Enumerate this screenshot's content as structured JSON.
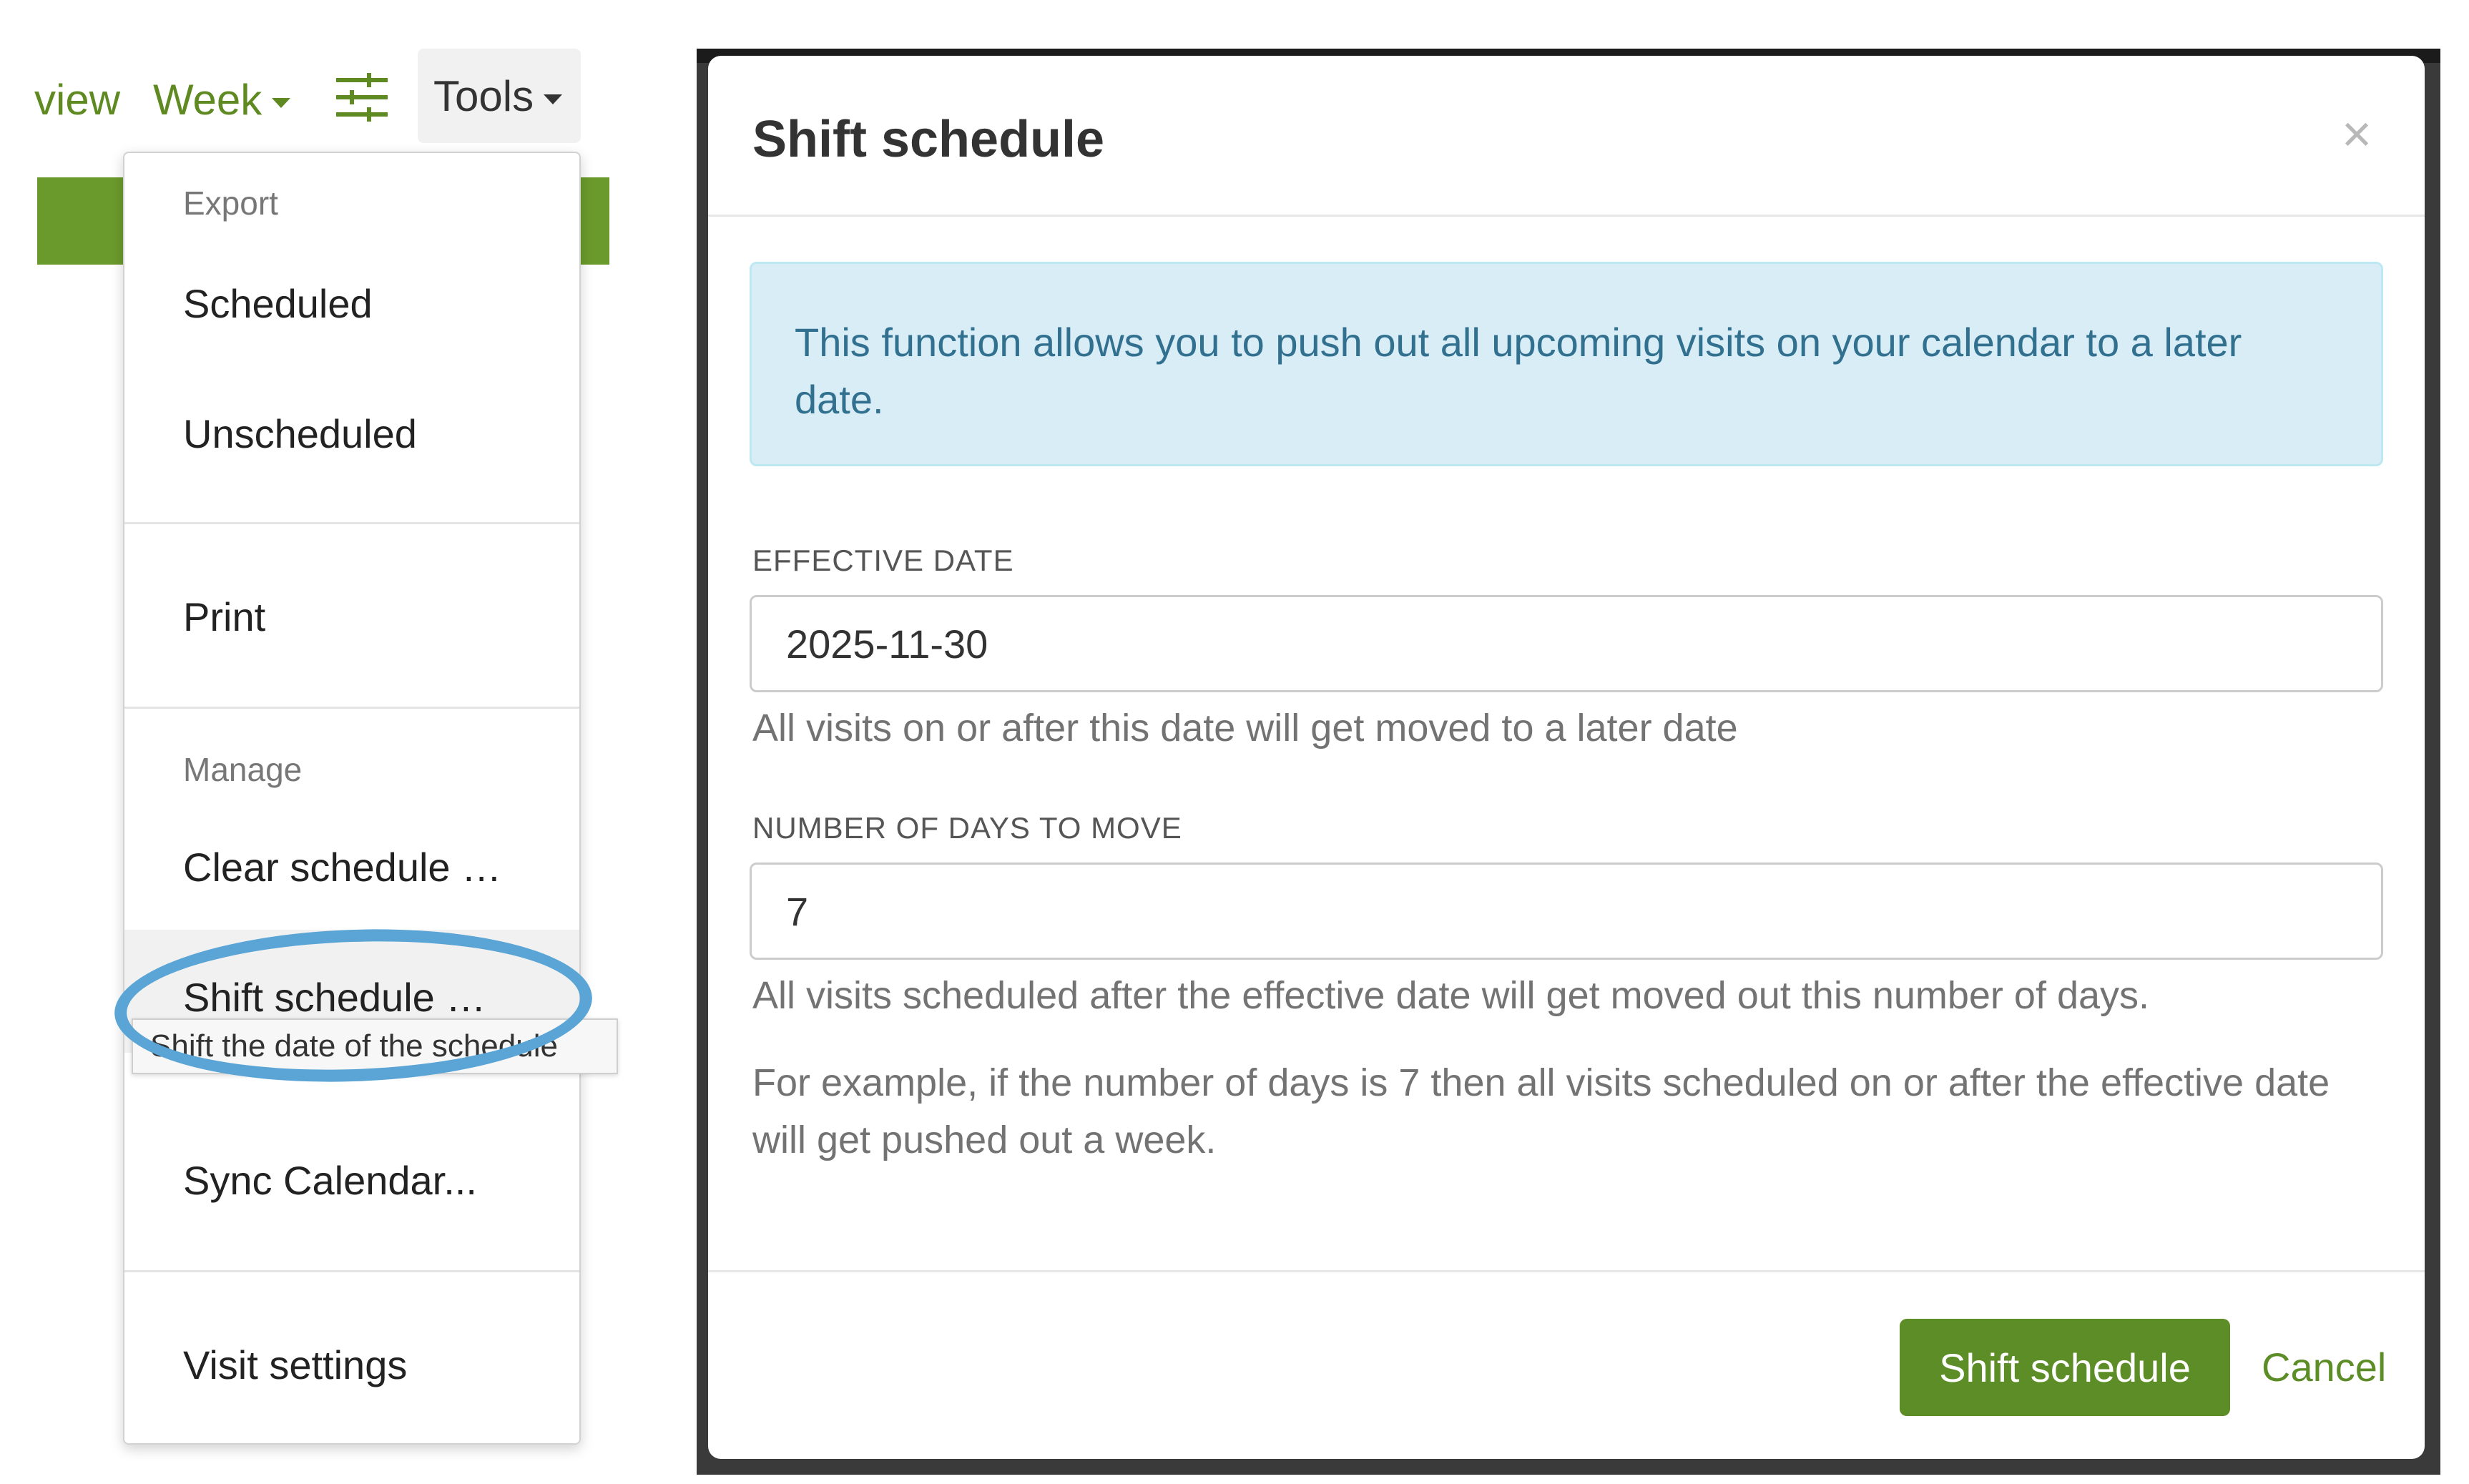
{
  "toolbar": {
    "view_label": "view",
    "week_label": "Week",
    "filter_icon": "sliders-icon",
    "tools_label": "Tools"
  },
  "menu": {
    "export_header": "Export",
    "scheduled": "Scheduled",
    "unscheduled": "Unscheduled",
    "print": "Print",
    "manage_header": "Manage",
    "clear_schedule": "Clear schedule …",
    "shift_schedule": "Shift schedule …",
    "sync_calendar": "Sync Calendar...",
    "visit_settings": "Visit settings",
    "tooltip": "Shift the date of the schedule"
  },
  "modal": {
    "title": "Shift schedule",
    "close_symbol": "×",
    "info": "This function allows you to push out all upcoming visits on your calendar to a later date.",
    "effective_date_label": "EFFECTIVE DATE",
    "effective_date_value": "2025-11-30",
    "effective_date_help": "All visits on or after this date will get moved to a later date",
    "days_label": "NUMBER OF DAYS TO MOVE",
    "days_value": "7",
    "days_help": "All visits scheduled after the effective date will get moved out this number of days.",
    "example_text": "For example, if the number of days is 7 then all visits scheduled on or after the effective date will get pushed out a week.",
    "submit_label": "Shift schedule",
    "cancel_label": "Cancel"
  },
  "colors": {
    "brand_green": "#5d8d26",
    "info_bg": "#d9edf7",
    "info_text": "#31708f",
    "highlight_blue": "#5aa5d6"
  }
}
